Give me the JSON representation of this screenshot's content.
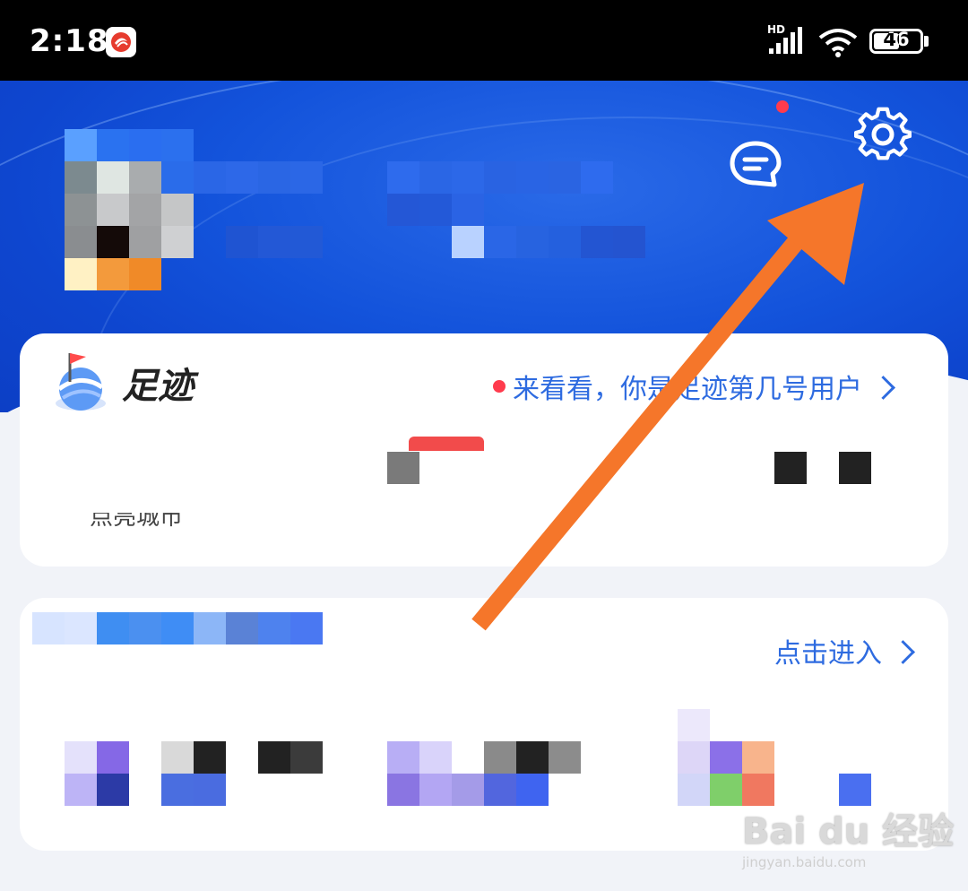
{
  "status_bar": {
    "time": "2:18",
    "network_label": "HD",
    "battery": "46",
    "icons": [
      "app-notification-icon",
      "signal-icon",
      "wifi-icon",
      "battery-icon"
    ]
  },
  "header": {
    "icons": [
      "message-icon",
      "settings-gear-icon"
    ],
    "message_has_badge": true,
    "accent_color": "#1353db"
  },
  "footprint_card": {
    "title": "足迹",
    "badge_color": "#ff3b4d",
    "link_text": "来看看，你是足迹第几号用户",
    "partial_text_left": "点亮城市"
  },
  "second_card": {
    "link_text": "点击进入"
  },
  "watermark": {
    "brand": "Bai du 经验",
    "url": "jingyan.baidu.com"
  },
  "annotation": {
    "arrow_color": "#f5762a",
    "points_to": "settings-gear-icon"
  }
}
